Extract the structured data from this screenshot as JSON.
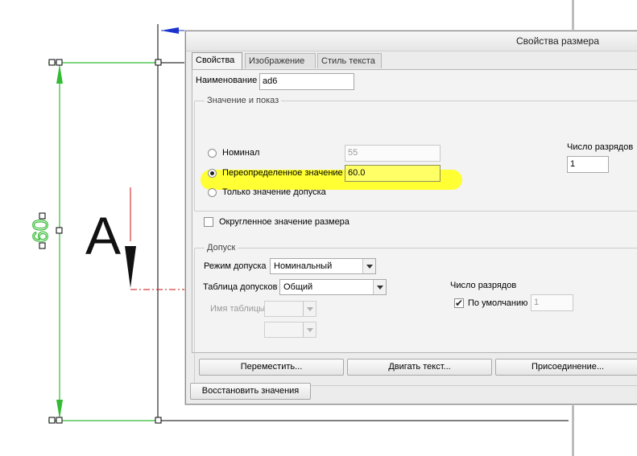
{
  "drawing": {
    "dimension_text": "60",
    "datum_letter": "A"
  },
  "dialog": {
    "title": "Свойства размера",
    "tabs": [
      {
        "label": "Свойства",
        "active": true
      },
      {
        "label": "Изображение",
        "active": false
      },
      {
        "label": "Стиль текста",
        "active": false
      }
    ],
    "name_label": "Наименование",
    "name_value": "ad6",
    "value_group": {
      "title": "Значение и показ",
      "nominal_label": "Номинал",
      "nominal_value": "55",
      "override_label": "Переопределенное значение",
      "override_value": "60.0",
      "tolerance_only_label": "Только значение допуска",
      "rounded_label": "Округленное значение размера",
      "selected": "override"
    },
    "decimals": {
      "label": "Число разрядов",
      "value": "1"
    },
    "tolerance_group": {
      "title": "Допуск",
      "mode_label": "Режим допуска",
      "mode_value": "Номинальный",
      "table_label": "Таблица допусков",
      "table_value": "Общий",
      "table_name_label": "Имя таблицы",
      "decimals_label": "Число разрядов",
      "default_label": "По умолчанию",
      "default_checked": true,
      "default_value": "1"
    },
    "buttons": {
      "move": "Переместить...",
      "move_text": "Двигать текст...",
      "attach": "Присоединение...",
      "restore": "Восстановить значения"
    },
    "highlight_color": "#ffff33"
  }
}
